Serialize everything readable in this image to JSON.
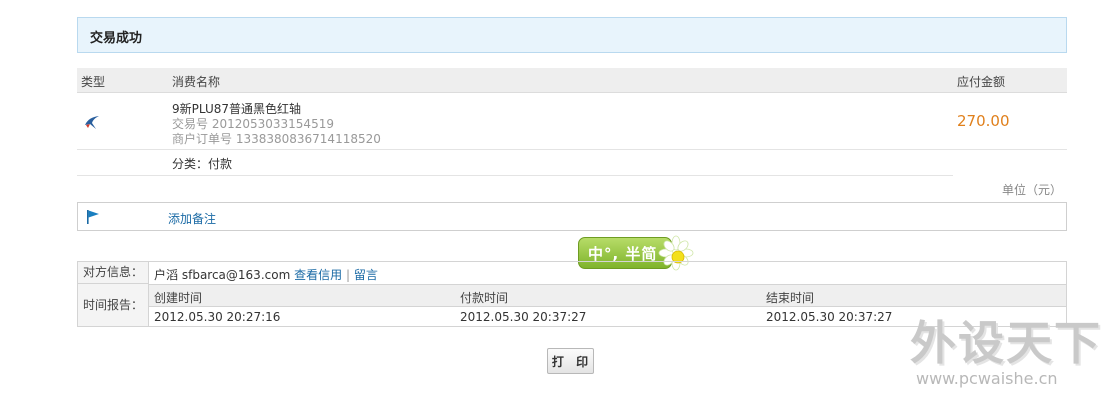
{
  "header": {
    "title": "交易成功"
  },
  "table": {
    "col_type": "类型",
    "col_name": "消费名称",
    "col_amount": "应付金额"
  },
  "item": {
    "name": "9新PLU87普通黑色红轴",
    "trade_no": "交易号 2012053033154519",
    "merchant_order_no": "商户订单号 1338380836714118520",
    "amount": "270.00",
    "category": "分类：付款"
  },
  "unit": "单位（元）",
  "remark": {
    "link": "添加备注"
  },
  "ime": {
    "label": "中°, 半简"
  },
  "info": {
    "party_label": "对方信息：",
    "party_name": "户滔",
    "party_email": "sfbarca@163.com",
    "credit_link": "查看信用",
    "separator": "|",
    "message_link": "留言",
    "time_label": "时间报告：",
    "created_label": "创建时间",
    "paid_label": "付款时间",
    "finished_label": "结束时间",
    "created_time": "2012.05.30 20:27:16",
    "paid_time": "2012.05.30 20:37:27",
    "finished_time": "2012.05.30 20:37:27"
  },
  "print_button": "打 印",
  "watermark": {
    "brand": "外设天下",
    "url": "www.pcwaishe.cn"
  },
  "colors": {
    "amount": "#e0801c",
    "link": "#1a6aa5",
    "success_bg": "#e8f4fc"
  }
}
